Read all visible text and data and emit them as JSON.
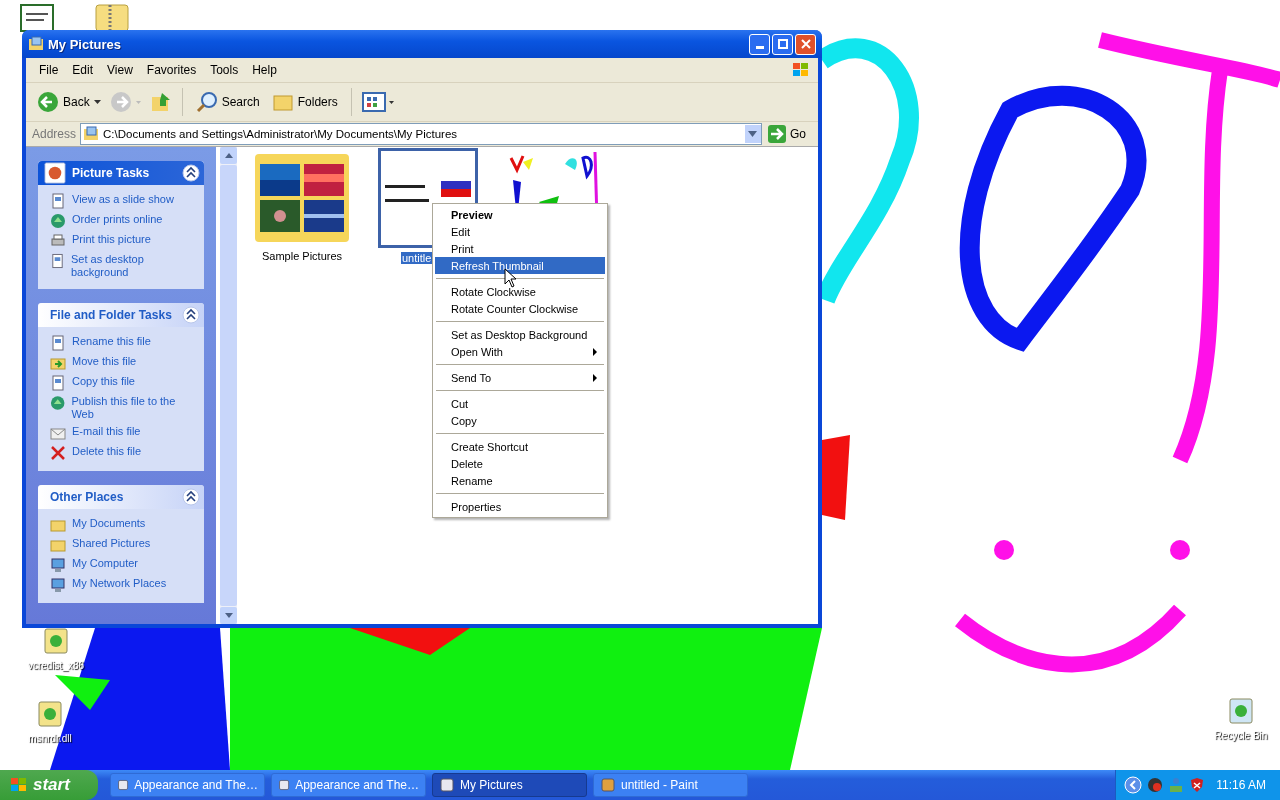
{
  "window": {
    "title": "My Pictures"
  },
  "menu": [
    "File",
    "Edit",
    "View",
    "Favorites",
    "Tools",
    "Help"
  ],
  "toolbar": {
    "back": "Back",
    "search": "Search",
    "folders": "Folders"
  },
  "address": {
    "label": "Address",
    "value": "C:\\Documents and Settings\\Administrator\\My Documents\\My Pictures",
    "go": "Go"
  },
  "panels": [
    {
      "title": "Picture Tasks",
      "expanded": true,
      "items": [
        "View as a slide show",
        "Order prints online",
        "Print this picture",
        "Set as desktop background"
      ]
    },
    {
      "title": "File and Folder Tasks",
      "expanded": true,
      "items": [
        "Rename this file",
        "Move this file",
        "Copy this file",
        "Publish this file to the Web",
        "E-mail this file",
        "Delete this file"
      ]
    },
    {
      "title": "Other Places",
      "expanded": true,
      "items": [
        "My Documents",
        "Shared Pictures",
        "My Computer",
        "My Network Places"
      ]
    }
  ],
  "files": [
    {
      "name": "Sample Pictures",
      "kind": "folder",
      "selected": false
    },
    {
      "name": "untitle",
      "kind": "picture",
      "selected": true
    },
    {
      "kind": "picture",
      "selected": false
    }
  ],
  "context_menu": [
    {
      "kind": "item",
      "label": "Preview",
      "default": true,
      "selected": false,
      "submenu": false
    },
    {
      "kind": "item",
      "label": "Edit",
      "default": false,
      "selected": false,
      "submenu": false
    },
    {
      "kind": "item",
      "label": "Print",
      "default": false,
      "selected": false,
      "submenu": false
    },
    {
      "kind": "item",
      "label": "Refresh Thumbnail",
      "default": false,
      "selected": true,
      "submenu": false
    },
    {
      "kind": "separator"
    },
    {
      "kind": "item",
      "label": "Rotate Clockwise",
      "default": false,
      "selected": false,
      "submenu": false
    },
    {
      "kind": "item",
      "label": "Rotate Counter Clockwise",
      "default": false,
      "selected": false,
      "submenu": false
    },
    {
      "kind": "separator"
    },
    {
      "kind": "item",
      "label": "Set as Desktop Background",
      "default": false,
      "selected": false,
      "submenu": false
    },
    {
      "kind": "item",
      "label": "Open With",
      "default": false,
      "selected": false,
      "submenu": true
    },
    {
      "kind": "separator"
    },
    {
      "kind": "item",
      "label": "Send To",
      "default": false,
      "selected": false,
      "submenu": true
    },
    {
      "kind": "separator"
    },
    {
      "kind": "item",
      "label": "Cut",
      "default": false,
      "selected": false,
      "submenu": false
    },
    {
      "kind": "item",
      "label": "Copy",
      "default": false,
      "selected": false,
      "submenu": false
    },
    {
      "kind": "separator"
    },
    {
      "kind": "item",
      "label": "Create Shortcut",
      "default": false,
      "selected": false,
      "submenu": false
    },
    {
      "kind": "item",
      "label": "Delete",
      "default": false,
      "selected": false,
      "submenu": false
    },
    {
      "kind": "item",
      "label": "Rename",
      "default": false,
      "selected": false,
      "submenu": false
    },
    {
      "kind": "separator"
    },
    {
      "kind": "item",
      "label": "Properties",
      "default": false,
      "selected": false,
      "submenu": false
    }
  ],
  "desktop_icons": [
    {
      "name": "vcredist_x86"
    },
    {
      "name": "msnrdr.dll"
    },
    {
      "name": "Recycle Bin"
    }
  ],
  "taskbar": {
    "start": "start",
    "tasks": [
      {
        "label": "Appearance and The…",
        "selected": false
      },
      {
        "label": "Appearance and The…",
        "selected": false
      },
      {
        "label": "My Pictures",
        "selected": true
      },
      {
        "label": "untitled - Paint",
        "selected": false
      }
    ],
    "clock": "11:16 AM"
  }
}
